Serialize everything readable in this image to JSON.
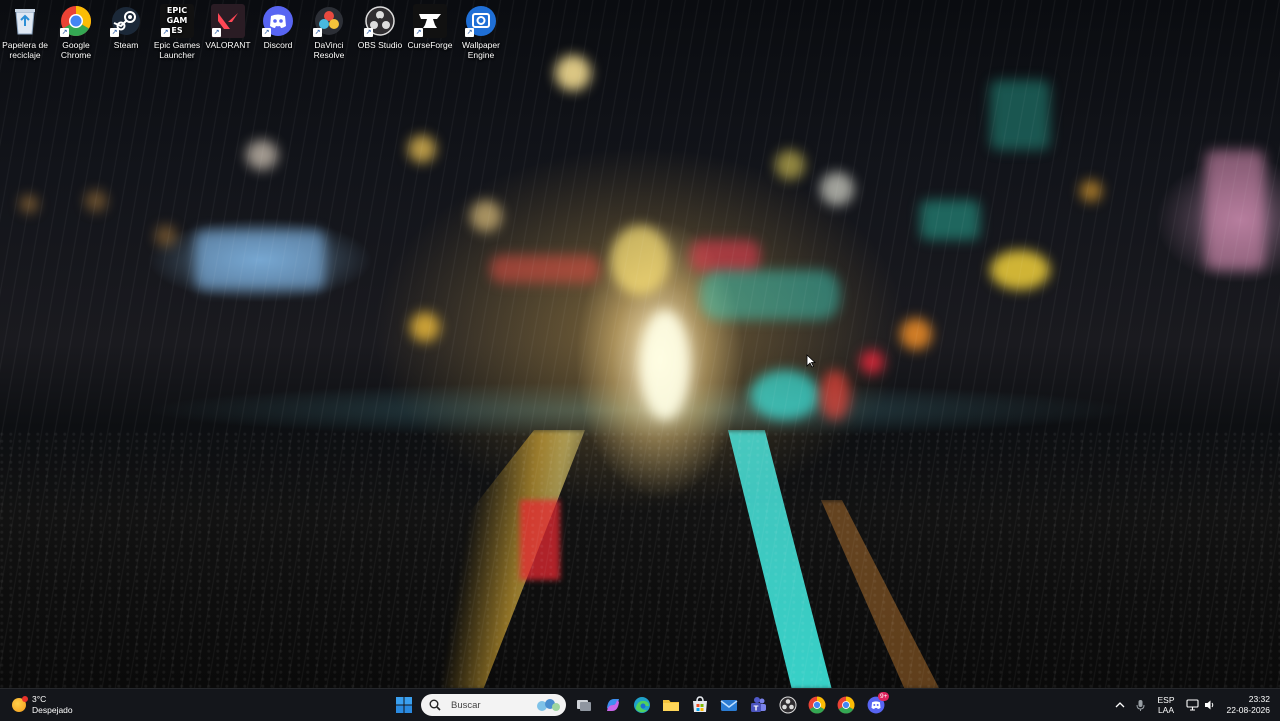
{
  "desktop": {
    "icons": [
      {
        "name": "recycle-bin",
        "label": "Papelera de reciclaje"
      },
      {
        "name": "google-chrome",
        "label": "Google Chrome"
      },
      {
        "name": "steam",
        "label": "Steam"
      },
      {
        "name": "epic-games-launcher",
        "label": "Epic Games Launcher",
        "logo_text": "EPIC GAMES"
      },
      {
        "name": "valorant",
        "label": "VALORANT"
      },
      {
        "name": "discord",
        "label": "Discord"
      },
      {
        "name": "davinci-resolve",
        "label": "DaVinci Resolve"
      },
      {
        "name": "obs-studio",
        "label": "OBS Studio"
      },
      {
        "name": "curseforge",
        "label": "CurseForge"
      },
      {
        "name": "wallpaper-engine",
        "label": "Wallpaper Engine"
      }
    ]
  },
  "taskbar": {
    "weather": {
      "temp": "3°C",
      "condition": "Despejado"
    },
    "search": {
      "placeholder": "Buscar"
    },
    "apps": [
      "start-icon",
      "search-box",
      "task-view-icon",
      "copilot-icon",
      "edge-icon",
      "file-explorer-icon",
      "microsoft-store-icon",
      "mail-icon",
      "teams-icon",
      "obs-icon",
      "chrome-icon",
      "chrome-icon",
      "discord-icon"
    ],
    "discord_badge": "9+",
    "tray": {
      "language": "ESP",
      "layout": "LAA",
      "time": "23:32",
      "date": "22-08-2026"
    }
  },
  "colors": {
    "taskbar_bg": "#16181c",
    "discord": "#5865f2",
    "chrome_red": "#ea4335",
    "chrome_green": "#34a853",
    "chrome_yellow": "#fbbc05",
    "chrome_blue": "#4285f4",
    "valorant": "#ff4655"
  }
}
